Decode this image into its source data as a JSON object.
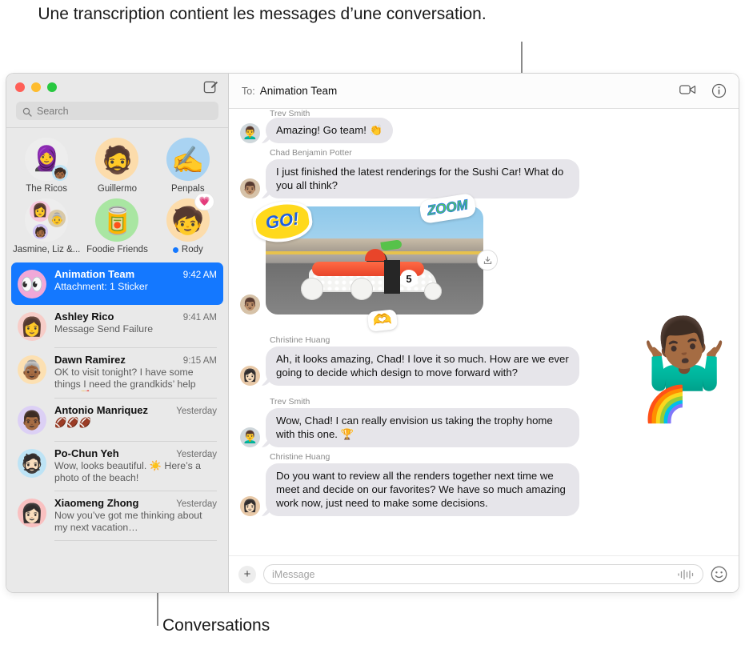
{
  "callouts": {
    "top": "Une transcription contient les messages d’une conversation.",
    "bottom": "Conversations"
  },
  "sidebar": {
    "compose_icon": "compose-icon",
    "search": {
      "placeholder": "Search",
      "icon": "search-icon"
    },
    "pinned": [
      {
        "name": "The Ricos",
        "avatar": "🧕",
        "bg": "#ededed",
        "badge": "",
        "status": ""
      },
      {
        "name": "Guillermo",
        "avatar": "🧔",
        "bg": "#fcdcab",
        "badge": "",
        "status": ""
      },
      {
        "name": "Penpals",
        "avatar": "✍️",
        "bg": "#a9d3f2",
        "badge": "",
        "status": ""
      },
      {
        "name": "Jasmine, Liz &...",
        "avatar": "👩",
        "bg": "#ededed",
        "badge": "",
        "status": ""
      },
      {
        "name": "Foodie Friends",
        "avatar": "🥫",
        "bg": "#a9e6a2",
        "badge": "",
        "status": ""
      },
      {
        "name": "Rody",
        "avatar": "🧒",
        "bg": "#fcdcab",
        "badge": "💗",
        "status": "unread"
      }
    ],
    "conversations": [
      {
        "name": "Animation Team",
        "time": "9:42 AM",
        "preview": "Attachment: 1 Sticker",
        "avatar": "👀",
        "bg": "#f0a8d8",
        "selected": true
      },
      {
        "name": "Ashley Rico",
        "time": "9:41 AM",
        "preview": "Message Send Failure",
        "avatar": "👩",
        "bg": "#f7cdc8",
        "selected": false
      },
      {
        "name": "Dawn Ramirez",
        "time": "9:15 AM",
        "preview": "OK to visit tonight? I have some things I need the grandkids’ help with. 🥰",
        "avatar": "👵🏾",
        "bg": "#fce0b2",
        "selected": false
      },
      {
        "name": "Antonio Manriquez",
        "time": "Yesterday",
        "preview": "🏈🏈🏈",
        "avatar": "👨🏾",
        "bg": "#dcd0f5",
        "selected": false
      },
      {
        "name": "Po-Chun Yeh",
        "time": "Yesterday",
        "preview": "Wow, looks beautiful. ☀️ Here’s a photo of the beach!",
        "avatar": "🧔🏻",
        "bg": "#bde3f5",
        "selected": false
      },
      {
        "name": "Xiaomeng Zhong",
        "time": "Yesterday",
        "preview": "Now you’ve got me thinking about my next vacation…",
        "avatar": "👩🏻",
        "bg": "#f9c0c0",
        "selected": false
      }
    ]
  },
  "pane": {
    "to_label": "To:",
    "to_value": "Animation Team",
    "facetime_icon": "video-camera-icon",
    "info_icon": "info-icon",
    "messages": [
      {
        "sender": "Trev Smith",
        "text": "Amazing! Go team! 👏",
        "avatar": "👨‍🦱",
        "bg": "#cfd7db",
        "type": "text"
      },
      {
        "sender": "Chad Benjamin Potter",
        "text": "I just finished the latest renderings for the Sushi Car! What do you all think?",
        "avatar": "👨🏽",
        "bg": "#d6c2a8",
        "type": "text"
      },
      {
        "sender": "",
        "text": "",
        "avatar": "👨🏽",
        "bg": "#d6c2a8",
        "type": "image",
        "image_alt": "Sushi soapbox derby car",
        "car_number": "5",
        "stickers": [
          "GO!",
          "ZOOM",
          "🫶"
        ],
        "save_icon": "download-icon"
      },
      {
        "sender": "Christine Huang",
        "text": "Ah, it looks amazing, Chad! I love it so much. How are we ever going to decide which design to move forward with?",
        "avatar": "👩🏻",
        "bg": "#e8c9a8",
        "type": "text",
        "overlay_sticker": "🤷🏾‍♂️"
      },
      {
        "sender": "Trev Smith",
        "text": "Wow, Chad! I can really envision us taking the trophy home with this one. 🏆",
        "avatar": "👨‍🦱",
        "bg": "#cfd7db",
        "type": "text",
        "overlay_sticker": "🌈"
      },
      {
        "sender": "Christine Huang",
        "text": "Do you want to review all the renders together next time we meet and decide on our favorites? We have so much amazing work now, just need to make some decisions.",
        "avatar": "👩🏻",
        "bg": "#e8c9a8",
        "type": "text"
      }
    ],
    "input": {
      "plus_label": "+",
      "placeholder": "iMessage",
      "audio_icon": "audio-waveform-icon",
      "emoji_icon": "emoji-smiley-icon"
    }
  },
  "colors": {
    "accent": "#1478ff",
    "bubble": "#e6e5ea",
    "sidebar": "#e9e9e9"
  }
}
